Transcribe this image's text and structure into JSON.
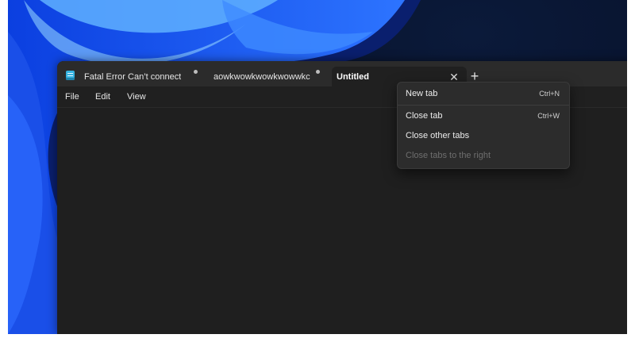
{
  "tabs": [
    {
      "label": "Fatal Error Can’t connect",
      "modified": true,
      "active": false
    },
    {
      "label": "aowkwowkwowkwowwkc",
      "modified": true,
      "active": false
    },
    {
      "label": "Untitled",
      "modified": false,
      "active": true
    }
  ],
  "tab_close_glyph": "✕",
  "new_tab_glyph": "+",
  "menu": {
    "file": "File",
    "edit": "Edit",
    "view": "View"
  },
  "context_menu": {
    "items": [
      {
        "label": "New tab",
        "shortcut": "Ctrl+N",
        "enabled": true
      },
      {
        "label": "Close tab",
        "shortcut": "Ctrl+W",
        "enabled": true
      },
      {
        "label": "Close other tabs",
        "shortcut": "",
        "enabled": true
      },
      {
        "label": "Close tabs to the right",
        "shortcut": "",
        "enabled": false
      }
    ]
  },
  "colors": {
    "window_bg": "#202020",
    "titlebar_bg": "#2b2b2b",
    "menu_bg": "#2c2c2c",
    "wallpaper_accent": "#1f5eff",
    "app_icon": "#36b3e0"
  },
  "icons": {
    "app": "notepad-icon",
    "close": "close-icon",
    "new_tab": "plus-icon",
    "modified": "unsaved-dot-icon"
  }
}
